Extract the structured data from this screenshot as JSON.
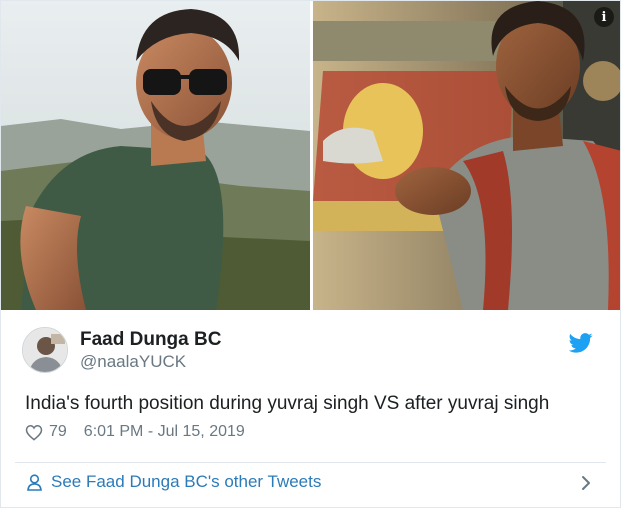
{
  "media": {
    "left_photo_alt": "man in sunglasses and green t-shirt",
    "right_photo_alt": "man in checked shirt next to a bus"
  },
  "tweet": {
    "display_name": "Faad Dunga BC",
    "handle": "@naalaYUCK",
    "text": "India's fourth position during yuvraj singh VS after yuvraj singh",
    "likes": "79",
    "timestamp": "6:01 PM - Jul 15, 2019"
  },
  "footer": {
    "link_text": "See Faad Dunga BC's other Tweets"
  },
  "icons": {
    "info": "info-icon",
    "bird": "twitter-bird-icon",
    "heart": "heart-icon",
    "person": "person-icon",
    "chevron": "chevron-right-icon"
  },
  "colors": {
    "link": "#2b7bb9",
    "twitter_blue": "#1da1f2",
    "secondary_text": "#697882",
    "primary_text": "#1c2022"
  }
}
